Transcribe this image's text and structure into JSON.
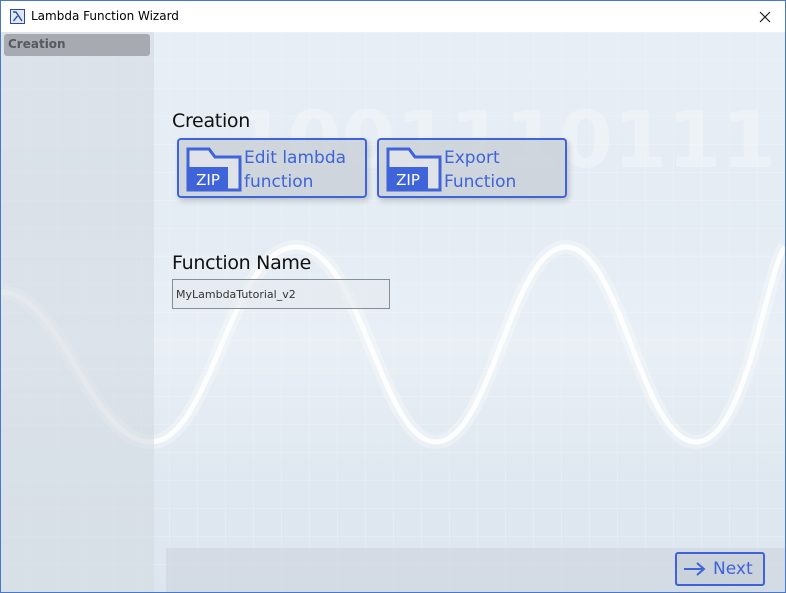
{
  "window": {
    "title": "Lambda Function Wizard",
    "app_icon": "lambda-icon",
    "close_icon": "close-icon"
  },
  "sidebar": {
    "items": [
      {
        "label": "Creation",
        "selected": true
      }
    ]
  },
  "main": {
    "creation_title": "Creation",
    "buttons": [
      {
        "label_line1": "Edit lambda",
        "label_line2": "function",
        "icon": "zip-folder-icon",
        "icon_text": "ZIP"
      },
      {
        "label_line1": "Export",
        "label_line2": "Function",
        "icon": "zip-folder-icon",
        "icon_text": "ZIP"
      }
    ],
    "function_name_title": "Function Name",
    "function_name_value": "MyLambdaTutorial_v2"
  },
  "footer": {
    "next_label": "Next",
    "next_icon": "arrow-right-icon"
  },
  "colors": {
    "accent": "#3f63d9",
    "background": "#e3ebf3",
    "sidebar_selected": "#a7abb1"
  }
}
